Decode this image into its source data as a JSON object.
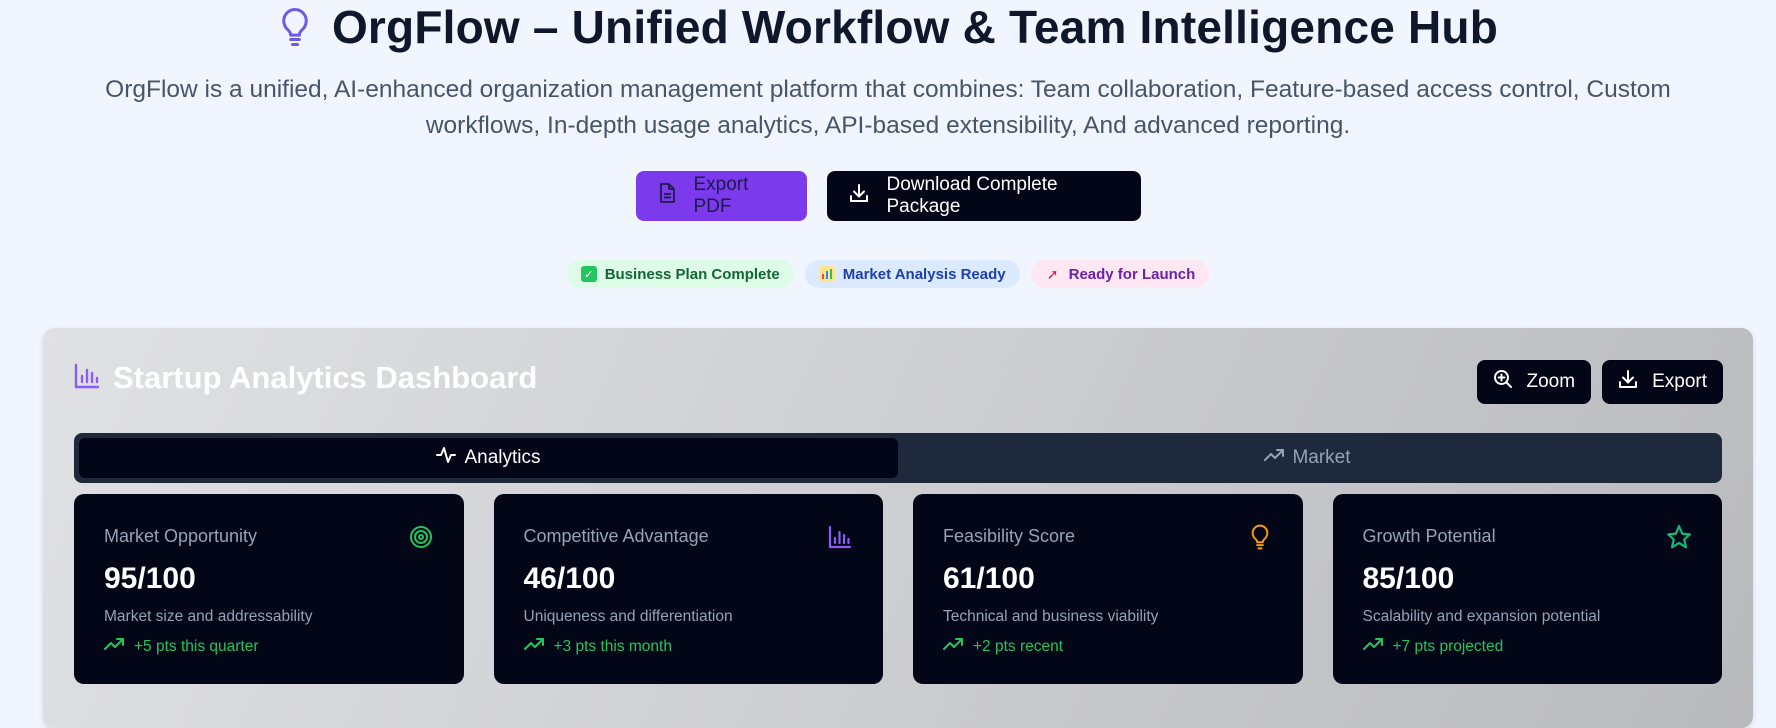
{
  "header": {
    "title": "OrgFlow – Unified Workflow & Team Intelligence Hub",
    "subtitle": "OrgFlow is a unified, AI-enhanced organization management platform that combines: Team collaboration, Feature-based access control, Custom workflows, In-depth usage analytics, API-based extensibility, And advanced reporting.",
    "icon": "lightbulb-icon"
  },
  "actions": {
    "export_pdf": "Export PDF",
    "download_package": "Download Complete Package"
  },
  "badges": [
    {
      "label": "Business Plan Complete",
      "icon": "check-emoji"
    },
    {
      "label": "Market Analysis Ready",
      "icon": "bar-chart-emoji"
    },
    {
      "label": "Ready for Launch",
      "icon": "rocket-emoji"
    }
  ],
  "dashboard": {
    "title": "Startup Analytics Dashboard",
    "zoom_label": "Zoom",
    "export_label": "Export",
    "tabs": [
      {
        "label": "Analytics",
        "active": true
      },
      {
        "label": "Market",
        "active": false
      }
    ],
    "cards": [
      {
        "label": "Market Opportunity",
        "value": "95/100",
        "desc": "Market size and addressability",
        "trend": "+5 pts this quarter",
        "icon": "target-icon",
        "icon_color": "#22c55e"
      },
      {
        "label": "Competitive Advantage",
        "value": "46/100",
        "desc": "Uniqueness and differentiation",
        "trend": "+3 pts this month",
        "icon": "bar-chart-icon",
        "icon_color": "#8b5cf6"
      },
      {
        "label": "Feasibility Score",
        "value": "61/100",
        "desc": "Technical and business viability",
        "trend": "+2 pts recent",
        "icon": "lightbulb-icon",
        "icon_color": "#f59e0b"
      },
      {
        "label": "Growth Potential",
        "value": "85/100",
        "desc": "Scalability and expansion potential",
        "trend": "+7 pts projected",
        "icon": "star-icon",
        "icon_color": "#10b981"
      }
    ]
  },
  "colors": {
    "accent_purple": "#7c3aed",
    "dark": "#020617",
    "trend_green": "#22c55e"
  }
}
